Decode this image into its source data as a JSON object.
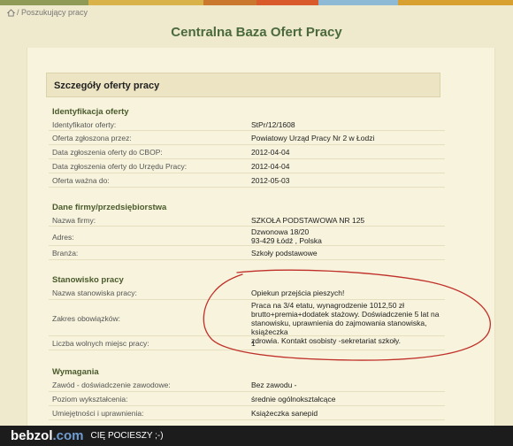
{
  "colors": {
    "top_bar": [
      "#8f9a57",
      "#d9b24a",
      "#c9782d",
      "#d95a2a",
      "#8fbad6",
      "#d7a02f"
    ],
    "title": "#4a6a3c",
    "annotation": "#c0302a"
  },
  "breadcrumb": {
    "icon": "home-icon",
    "text": "/ Poszukujący pracy"
  },
  "page_title": "Centralna Baza Ofert Pracy",
  "details": {
    "header": "Szczegóły oferty pracy",
    "identification": {
      "title": "Identyfikacja oferty",
      "rows": [
        {
          "label": "Identyfikator oferty:",
          "value": "StPr/12/1608"
        },
        {
          "label": "Oferta zgłoszona przez:",
          "value": "Powiatowy Urząd Pracy Nr 2 w Łodzi"
        },
        {
          "label": "Data zgłoszenia oferty do CBOP:",
          "value": "2012-04-04"
        },
        {
          "label": "Data zgłoszenia oferty do Urzędu Pracy:",
          "value": "2012-04-04"
        },
        {
          "label": "Oferta ważna do:",
          "value": "2012-05-03"
        }
      ]
    },
    "company": {
      "title": "Dane firmy/przedsiębiorstwa",
      "rows": [
        {
          "label": "Nazwa firmy:",
          "value": "SZKOŁA PODSTAWOWA NR 125"
        },
        {
          "label": "Adres:",
          "value": "Dzwonowa 18/20\n93-429 Łódź , Polska"
        },
        {
          "label": "Branża:",
          "value": "Szkoły podstawowe"
        }
      ]
    },
    "position": {
      "title": "Stanowisko pracy",
      "rows": [
        {
          "label": "Nazwa stanowiska pracy:",
          "value": "Opiekun przejścia pieszych!"
        },
        {
          "label": "Zakres obowiązków:",
          "value": "Praca na 3/4 etatu, wynagrodzenie 1012,50 zł\nbrutto+premia+dodatek stażowy. Doświadczenie 5 lat na\nstanowisku, uprawnienia do zajmowania stanowiska, książeczka\nzdrowia. Kontakt osobisty -sekretariat szkoły."
        },
        {
          "label": "Liczba wolnych miejsc pracy:",
          "value": "1"
        }
      ]
    },
    "requirements": {
      "title": "Wymagania",
      "rows": [
        {
          "label": "Zawód - doświadczenie zawodowe:",
          "value": "Bez zawodu -"
        },
        {
          "label": "Poziom wykształcenia:",
          "value": "średnie ogólnokształcące"
        },
        {
          "label": "Umiejętności i uprawnienia:",
          "value": "Książeczka sanepid"
        }
      ]
    }
  },
  "footer": {
    "brand_main": "bebzol",
    "brand_tld": ".com",
    "tagline": "CIĘ POCIESZY ;-)"
  }
}
